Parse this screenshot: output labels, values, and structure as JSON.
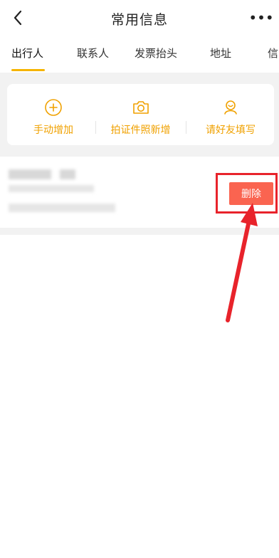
{
  "header": {
    "title": "常用信息",
    "back_icon": "chevron-left-icon",
    "more_label": "•••"
  },
  "tabs": [
    {
      "label": "出行人",
      "active": true
    },
    {
      "label": "联系人",
      "active": false
    },
    {
      "label": "发票抬头",
      "active": false
    },
    {
      "label": "地址",
      "active": false
    },
    {
      "label": "信",
      "active": false
    }
  ],
  "actions": [
    {
      "label": "手动增加",
      "icon": "plus-circle-icon"
    },
    {
      "label": "拍证件照新增",
      "icon": "camera-icon"
    },
    {
      "label": "请好友填写",
      "icon": "user-invite-icon"
    }
  ],
  "passenger": {
    "delete_label": "删除"
  },
  "colors": {
    "accent": "#f0a100",
    "tab_underline": "#f5b400",
    "delete_bg": "#fa6450",
    "annotation_red": "#e8232b",
    "band_gray": "#f2f2f2"
  }
}
